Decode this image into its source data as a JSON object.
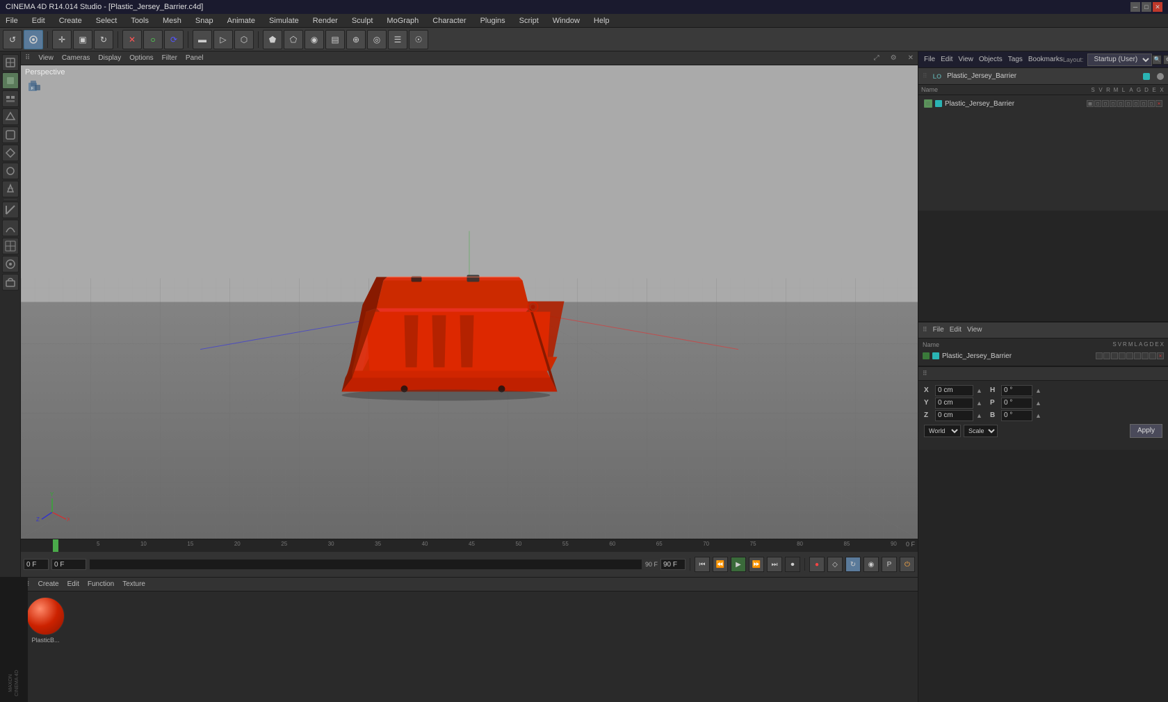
{
  "app": {
    "title": "CINEMA 4D R14.014 Studio - [Plastic_Jersey_Barrier.c4d]",
    "layout": "Startup (User)"
  },
  "title_bar": {
    "title": "CINEMA 4D R14.014 Studio - [Plastic_Jersey_Barrier.c4d]",
    "layout_label": "Layout:",
    "layout_value": "Startup (User)"
  },
  "menu_bar": {
    "items": [
      "File",
      "Edit",
      "Create",
      "Select",
      "Tools",
      "Mesh",
      "Snap",
      "Animate",
      "Simulate",
      "Render",
      "Sculpt",
      "MoGraph",
      "Character",
      "Plugins",
      "Script",
      "Window",
      "Help"
    ]
  },
  "toolbar": {
    "tools": [
      "↺",
      "⊙",
      "✛",
      "▣",
      "↻",
      "✛",
      "✕",
      "○",
      "⟳",
      "▬",
      "▷",
      "⟶",
      "⟵",
      "⬡",
      "⬟",
      "⬠",
      "◉",
      "▤",
      "⊕",
      "◎",
      "☰",
      "☉"
    ]
  },
  "viewport": {
    "perspective_label": "Perspective",
    "menu_items": [
      "View",
      "Cameras",
      "Display",
      "Options",
      "Filter",
      "Panel"
    ]
  },
  "objects_panel": {
    "header_menus": [
      "File",
      "Edit",
      "View"
    ],
    "object_name": "Plastic_Jersey_Barrier",
    "col_headers": [
      "Name",
      "S",
      "V",
      "R",
      "M",
      "L",
      "A",
      "G",
      "D",
      "E",
      "X"
    ],
    "object_color": "#2ab4b4"
  },
  "right_panel": {
    "header_menus": [
      "File",
      "Edit",
      "View"
    ],
    "object_name": "Plastic_Jersey_Barrier",
    "col_headers": [
      "Name",
      "S",
      "V",
      "R",
      "M",
      "L",
      "A",
      "G",
      "D",
      "E",
      "X"
    ]
  },
  "coordinates": {
    "x_pos": "0 cm",
    "y_pos": "0 cm",
    "z_pos": "0 cm",
    "x_rot": "0°",
    "y_rot": "0°",
    "z_rot": "0°",
    "h_val": "0°",
    "p_val": "0°",
    "b_val": "0°",
    "world_label": "World",
    "scale_label": "Scale",
    "apply_label": "Apply"
  },
  "timeline": {
    "current_frame": "0 F",
    "frame_input": "0 F",
    "end_frame": "90 F",
    "end_input": "90 F",
    "ruler_values": [
      "0",
      "5",
      "10",
      "15",
      "20",
      "25",
      "30",
      "35",
      "40",
      "45",
      "50",
      "55",
      "60",
      "65",
      "70",
      "75",
      "80",
      "85",
      "90",
      "0 F"
    ]
  },
  "material": {
    "name": "PlasticB...",
    "menu_items": [
      "Create",
      "Edit",
      "Function",
      "Texture"
    ]
  },
  "maxon_logo": "MAXON\nCINEMA 4D"
}
